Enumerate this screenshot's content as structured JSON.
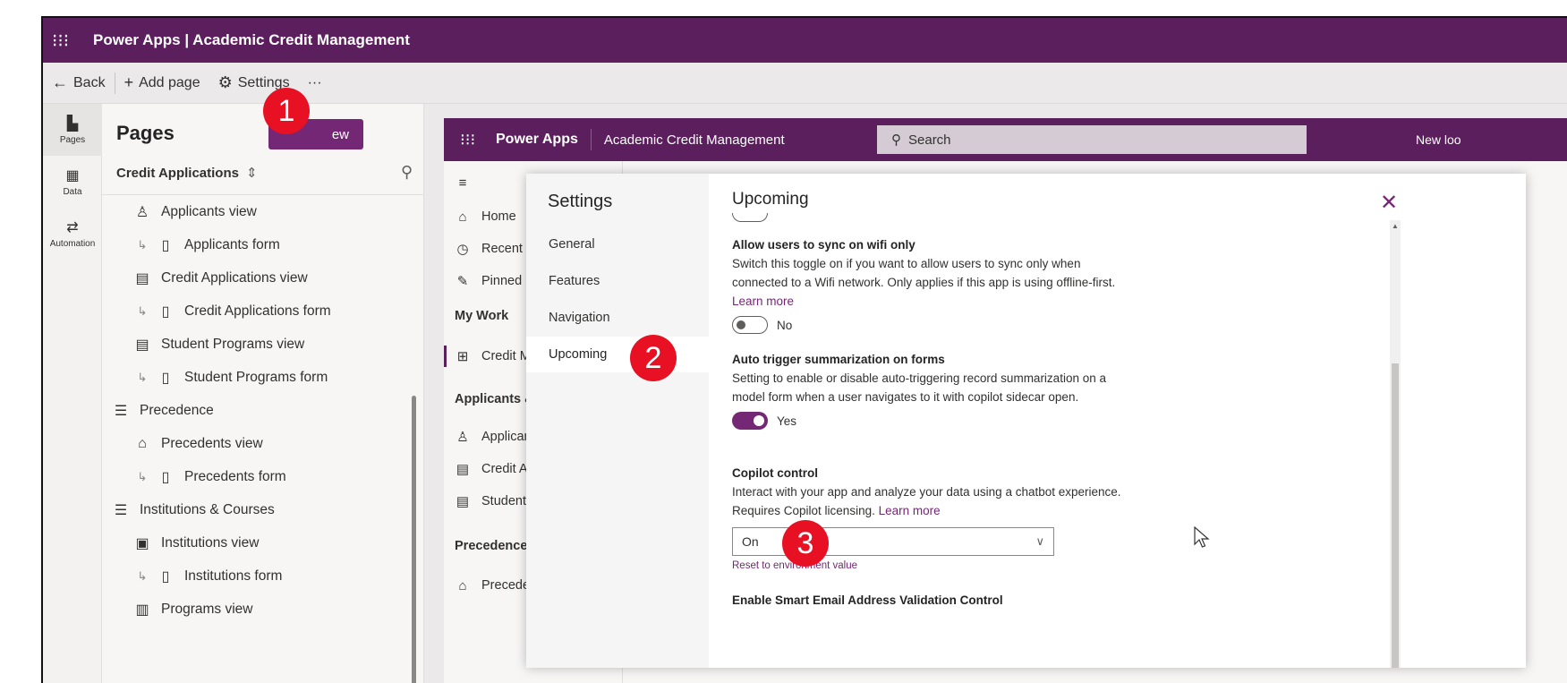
{
  "maker": {
    "title": "Power Apps | Academic Credit Management",
    "commands": {
      "back": "Back",
      "add_page": "Add page",
      "settings": "Settings",
      "more": "···"
    },
    "rail": [
      {
        "label": "Pages",
        "icon": "page-icon"
      },
      {
        "label": "Data",
        "icon": "table-icon"
      },
      {
        "label": "Automation",
        "icon": "flow-icon"
      }
    ]
  },
  "pages_panel": {
    "title": "Pages",
    "new_button": "ew",
    "app_selector": "Credit Applications",
    "items": [
      {
        "label": "Applicants view",
        "icon": "person-icon",
        "level": 2
      },
      {
        "label": "Applicants form",
        "icon": "document-icon",
        "level": 3
      },
      {
        "label": "Credit Applications view",
        "icon": "view-icon",
        "level": 2
      },
      {
        "label": "Credit Applications form",
        "icon": "document-icon",
        "level": 3
      },
      {
        "label": "Student Programs view",
        "icon": "view-icon",
        "level": 2
      },
      {
        "label": "Student Programs form",
        "icon": "document-icon",
        "level": 3
      },
      {
        "label": "Precedence",
        "icon": "group-icon",
        "level": 1
      },
      {
        "label": "Precedents view",
        "icon": "cap-icon",
        "level": 2
      },
      {
        "label": "Precedents form",
        "icon": "document-icon",
        "level": 3
      },
      {
        "label": "Institutions & Courses",
        "icon": "group-icon",
        "level": 1
      },
      {
        "label": "Institutions view",
        "icon": "building-icon",
        "level": 2
      },
      {
        "label": "Institutions form",
        "icon": "document-icon",
        "level": 3
      },
      {
        "label": "Programs view",
        "icon": "book-icon",
        "level": 2
      }
    ]
  },
  "preview_app": {
    "brand": "Power Apps",
    "app_title": "Academic Credit Management",
    "search_placeholder": "Search",
    "new_look": "New loo",
    "sitemap": {
      "home": "Home",
      "recent": "Recent",
      "pinned": "Pinned",
      "my_work": "My Work",
      "credit_management": "Credit Management",
      "group_applicants": "Applicants & Applicatior",
      "applicants": "Applicants",
      "credit_applications": "Credit Applications",
      "student_programs": "Student Programs",
      "group_precedence": "Precedence",
      "precedents": "Precedents"
    }
  },
  "settings_dialog": {
    "title": "Settings",
    "nav": [
      "General",
      "Features",
      "Navigation",
      "Upcoming"
    ],
    "active_nav": "Upcoming",
    "section_title": "Upcoming",
    "items": [
      {
        "name": "Allow users to sync on wifi only",
        "desc": "Switch this toggle on if you want to allow users to sync only when connected to a Wifi network. Only applies if this app is using offline-first.",
        "link": "Learn more",
        "toggle_on": false,
        "toggle_label": "No"
      },
      {
        "name": "Auto trigger summarization on forms",
        "desc": "Setting to enable or disable auto-triggering record summarization on a model form when a user navigates to it with copilot sidecar open.",
        "toggle_on": true,
        "toggle_label": "Yes"
      },
      {
        "name": "Copilot control",
        "desc": "Interact with your app and analyze your data using a chatbot experience. Requires Copilot licensing.",
        "link": "Learn more",
        "dropdown_value": "On",
        "reset": "Reset to environment value"
      },
      {
        "name": "Enable Smart Email Address Validation Control"
      }
    ]
  },
  "callouts": [
    "1",
    "2",
    "3"
  ],
  "colors": {
    "brand": "#5c1f5e",
    "accent": "#742774",
    "callout": "#e81123"
  }
}
